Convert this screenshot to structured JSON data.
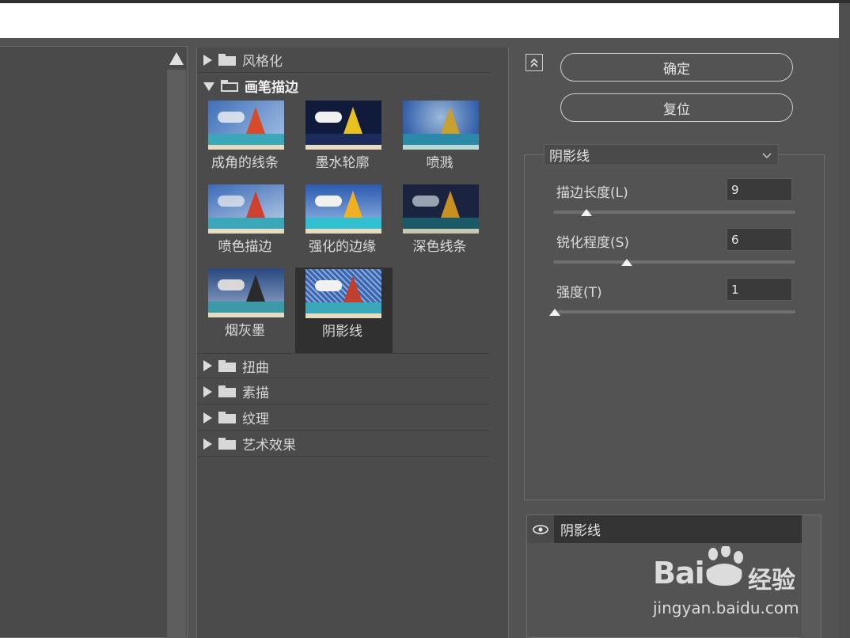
{
  "filter_categories_top": [
    {
      "label": "风格化",
      "expanded": false
    },
    {
      "label": "画笔描边",
      "expanded": true
    }
  ],
  "thumbnails": [
    {
      "label": "成角的线条",
      "selected": false
    },
    {
      "label": "墨水轮廓",
      "selected": false
    },
    {
      "label": "喷溅",
      "selected": false
    },
    {
      "label": "喷色描边",
      "selected": false
    },
    {
      "label": "强化的边缘",
      "selected": false
    },
    {
      "label": "深色线条",
      "selected": false
    },
    {
      "label": "烟灰墨",
      "selected": false
    },
    {
      "label": "阴影线",
      "selected": true
    }
  ],
  "filter_categories_bottom": [
    {
      "label": "扭曲"
    },
    {
      "label": "素描"
    },
    {
      "label": "纹理"
    },
    {
      "label": "艺术效果"
    }
  ],
  "buttons": {
    "ok": "确定",
    "reset": "复位"
  },
  "settings": {
    "selected_filter": "阴影线",
    "params": [
      {
        "label": "描边长度(L)",
        "value": "9",
        "slider_fraction": 0.14
      },
      {
        "label": "锐化程度(S)",
        "value": "6",
        "slider_fraction": 0.3
      },
      {
        "label": "强度(T)",
        "value": "1",
        "slider_fraction": 0.0
      }
    ]
  },
  "layers": [
    {
      "name": "阴影线",
      "visible": true
    }
  ],
  "watermark": {
    "brand": "Bai",
    "brand_cn": "经验",
    "url": "jingyan.baidu.com"
  },
  "icons": {
    "collapse": "double-chevron-up-icon",
    "eye": "eye-icon",
    "folder": "folder-icon",
    "dropdown": "chevron-down-icon",
    "scroll_up": "triangle-up-icon"
  }
}
